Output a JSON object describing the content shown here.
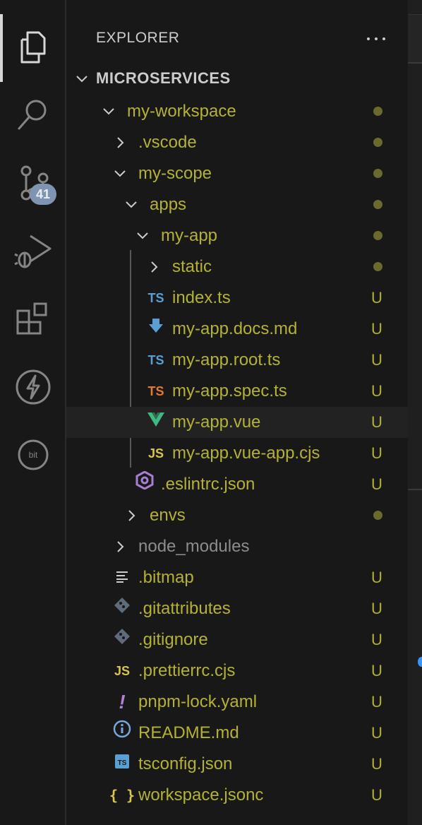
{
  "activity": {
    "scm_badge": "41"
  },
  "explorer": {
    "title": "EXPLORER",
    "section": "MICROSERVICES"
  },
  "tree": [
    {
      "label": "my-workspace",
      "status": "dot",
      "chevron": "down",
      "icon": "none"
    },
    {
      "label": ".vscode",
      "status": "dot",
      "chevron": "right",
      "icon": "none"
    },
    {
      "label": "my-scope",
      "status": "dot",
      "chevron": "down",
      "icon": "none"
    },
    {
      "label": "apps",
      "status": "dot",
      "chevron": "down",
      "icon": "none"
    },
    {
      "label": "my-app",
      "status": "dot",
      "chevron": "down",
      "icon": "none"
    },
    {
      "label": "static",
      "status": "dot",
      "chevron": "right",
      "icon": "none"
    },
    {
      "label": "index.ts",
      "status": "U",
      "icon": "typescript-icon",
      "icon_text": "TS"
    },
    {
      "label": "my-app.docs.md",
      "status": "U",
      "icon": "markdown-download-icon"
    },
    {
      "label": "my-app.root.ts",
      "status": "U",
      "icon": "typescript-icon",
      "icon_text": "TS"
    },
    {
      "label": "my-app.spec.ts",
      "status": "U",
      "icon": "typescript-test-icon",
      "icon_text": "TS"
    },
    {
      "label": "my-app.vue",
      "status": "U",
      "icon": "vue-icon",
      "selected": true
    },
    {
      "label": "my-app.vue-app.cjs",
      "status": "U",
      "icon": "javascript-icon",
      "icon_text": "JS"
    },
    {
      "label": ".eslintrc.json",
      "status": "U",
      "icon": "eslint-icon"
    },
    {
      "label": "envs",
      "status": "dot",
      "chevron": "right",
      "icon": "none"
    },
    {
      "label": "node_modules",
      "status": "",
      "chevron": "right",
      "icon": "none",
      "muted": true
    },
    {
      "label": ".bitmap",
      "status": "U",
      "icon": "lines-icon"
    },
    {
      "label": ".gitattributes",
      "status": "U",
      "icon": "git-icon"
    },
    {
      "label": ".gitignore",
      "status": "U",
      "icon": "git-icon"
    },
    {
      "label": ".prettierrc.cjs",
      "status": "U",
      "icon": "javascript-icon",
      "icon_text": "JS"
    },
    {
      "label": "pnpm-lock.yaml",
      "status": "U",
      "icon": "yaml-icon",
      "icon_text": "!"
    },
    {
      "label": "README.md",
      "status": "U",
      "icon": "info-icon"
    },
    {
      "label": "tsconfig.json",
      "status": "U",
      "icon": "tsconfig-icon",
      "icon_text": "TS"
    },
    {
      "label": "workspace.jsonc",
      "status": "U",
      "icon": "json-icon",
      "icon_text": "{ }"
    }
  ],
  "colors": {
    "untracked": "#b3b235",
    "muted": "#8c8c8c",
    "dot": "#6a6a2e"
  }
}
